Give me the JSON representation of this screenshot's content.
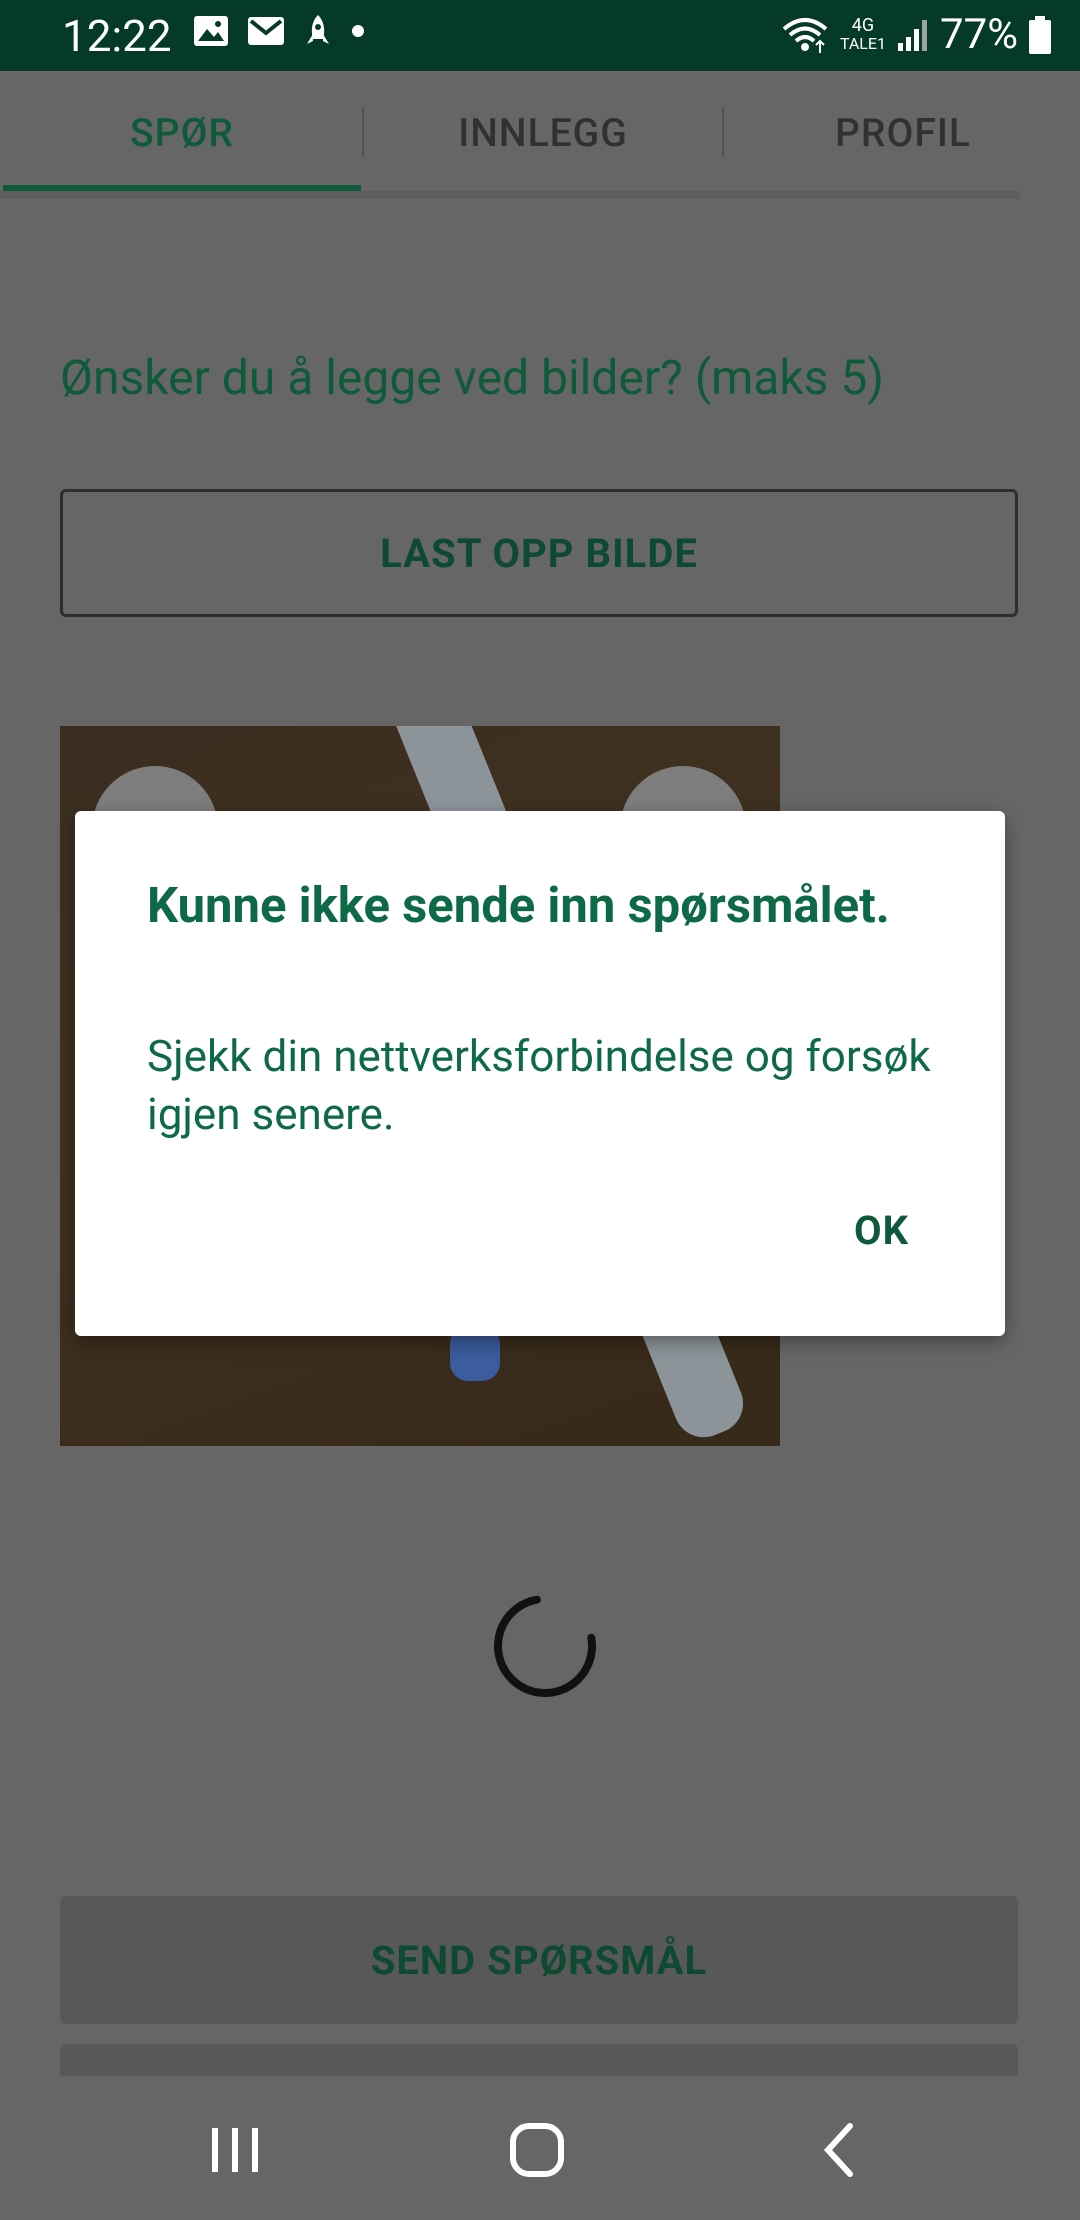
{
  "status_bar": {
    "time": "12:22",
    "network": "4G",
    "carrier_label": "TALE1",
    "battery_percent": "77%"
  },
  "tabs": [
    {
      "label": "SPØR",
      "active": true
    },
    {
      "label": "INNLEGG",
      "active": false
    },
    {
      "label": "PROFIL",
      "active": false
    }
  ],
  "form": {
    "images_question": "Ønsker du å legge ved bilder? (maks 5)",
    "upload_button": "LAST OPP BILDE",
    "send_button": "SEND SPØRSMÅL"
  },
  "dialog": {
    "title": "Kunne ikke sende inn spørsmålet.",
    "message": "Sjekk din nettverksforbindelse og forsøk igjen senere.",
    "ok_button": "OK"
  },
  "colors": {
    "status_bar": "#053a28",
    "accent": "#0e5a3a",
    "dialog_text": "#0e6a46"
  }
}
